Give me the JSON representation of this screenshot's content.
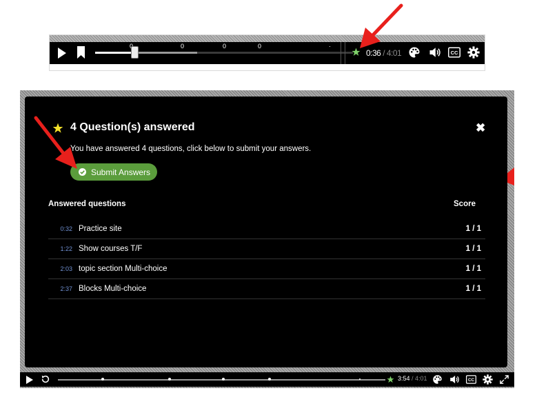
{
  "top_player": {
    "markers": [
      "0",
      "0",
      "0",
      "0",
      "·"
    ],
    "current_time": "0:36",
    "separator": " / ",
    "total_time": "4:01",
    "progress": 0.149
  },
  "dialog": {
    "title": "4 Question(s) answered",
    "close_label": "✖",
    "description": "You have answered 4 questions, click below to submit your answers.",
    "submit_label": "Submit Answers",
    "answered_heading": "Answered questions",
    "score_heading": "Score",
    "questions": [
      {
        "time": "0:32",
        "label": "Practice site",
        "score": "1 / 1"
      },
      {
        "time": "1:22",
        "label": "Show courses T/F",
        "score": "1 / 1"
      },
      {
        "time": "2:03",
        "label": "topic section Multi-choice",
        "score": "1 / 1"
      },
      {
        "time": "2:37",
        "label": "Blocks Multi-choice",
        "score": "1 / 1"
      }
    ]
  },
  "bottom_player": {
    "current_time": "3:54",
    "separator": " / ",
    "total_time": "4:01"
  },
  "side": {
    "chevron": "›"
  },
  "colors": {
    "accent_green": "#5b9d3c",
    "star_yellow": "#f4e12a",
    "arrow_red": "#e8201c",
    "time_blue": "#6f8fd0"
  },
  "icons": [
    "play-icon",
    "bookmark-icon",
    "star-icon",
    "palette-icon",
    "volume-icon",
    "cc-icon",
    "gear-icon",
    "rewind-icon",
    "fullscreen-icon",
    "close-icon",
    "check-circle-icon"
  ]
}
